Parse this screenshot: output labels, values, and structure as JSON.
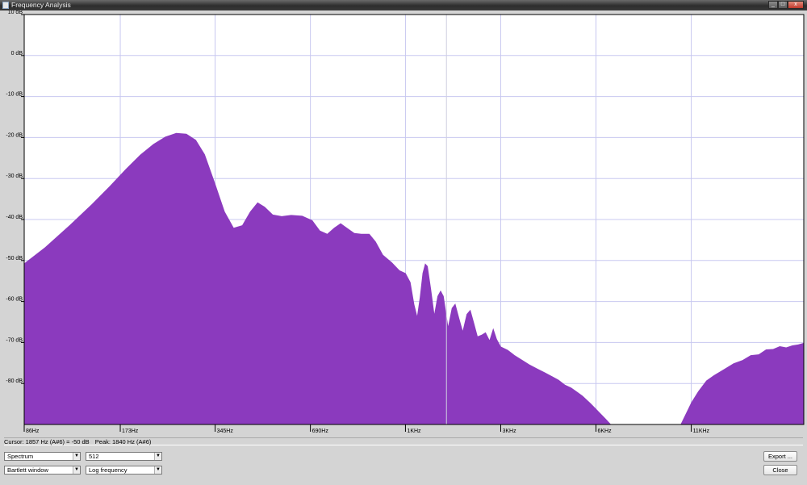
{
  "window": {
    "title": "Frequency Analysis",
    "min": "_",
    "max": "□",
    "close": "x"
  },
  "status": {
    "cursor": "Cursor: 1857 Hz (A#6) = -50 dB",
    "peak": "Peak: 1840 Hz (A#6)"
  },
  "controls": {
    "algorithm": "Spectrum",
    "size": "512",
    "window_function": "Bartlett window",
    "axis": "Log frequency",
    "export_label": "Export ...",
    "close_label": "Close"
  },
  "colors": {
    "fill": "#8b3abe",
    "grid": "#c8c8f0",
    "cursor_line": "#d0d0e0"
  },
  "chart_data": {
    "type": "area",
    "x_scale": "log",
    "xlim_hz": [
      86,
      25000
    ],
    "ylim_db": [
      -90,
      10
    ],
    "grid": true,
    "x_ticks": [
      {
        "hz": 86,
        "label": "86Hz"
      },
      {
        "hz": 173,
        "label": "173Hz"
      },
      {
        "hz": 345,
        "label": "345Hz"
      },
      {
        "hz": 690,
        "label": "690Hz"
      },
      {
        "hz": 1378,
        "label": "1KHz"
      },
      {
        "hz": 2756,
        "label": "3KHz"
      },
      {
        "hz": 5512,
        "label": "6KHz"
      },
      {
        "hz": 11025,
        "label": "11KHz"
      }
    ],
    "y_ticks": [
      {
        "db": 10,
        "label": "10 dB"
      },
      {
        "db": 0,
        "label": "0 dB"
      },
      {
        "db": -10,
        "label": "-10 dB"
      },
      {
        "db": -20,
        "label": "-20 dB"
      },
      {
        "db": -30,
        "label": "-30 dB"
      },
      {
        "db": -40,
        "label": "-40 dB"
      },
      {
        "db": -50,
        "label": "-50 dB"
      },
      {
        "db": -60,
        "label": "-60 dB"
      },
      {
        "db": -70,
        "label": "-70 dB"
      },
      {
        "db": -80,
        "label": "-80 dB"
      }
    ],
    "cursor_hz": 1857,
    "series": [
      {
        "points": [
          [
            86,
            -50.7
          ],
          [
            100,
            -46.8
          ],
          [
            120,
            -41.3
          ],
          [
            140,
            -36.4
          ],
          [
            160,
            -31.9
          ],
          [
            180,
            -27.7
          ],
          [
            200,
            -24.2
          ],
          [
            220,
            -21.6
          ],
          [
            240,
            -19.8
          ],
          [
            260,
            -18.9
          ],
          [
            280,
            -19.1
          ],
          [
            300,
            -20.6
          ],
          [
            320,
            -24.1
          ],
          [
            345,
            -31.2
          ],
          [
            370,
            -38.1
          ],
          [
            395,
            -42.0
          ],
          [
            420,
            -41.4
          ],
          [
            445,
            -38.1
          ],
          [
            470,
            -35.8
          ],
          [
            495,
            -36.9
          ],
          [
            525,
            -38.8
          ],
          [
            560,
            -39.2
          ],
          [
            600,
            -38.9
          ],
          [
            650,
            -39.1
          ],
          [
            700,
            -40.2
          ],
          [
            740,
            -42.7
          ],
          [
            780,
            -43.5
          ],
          [
            820,
            -42.0
          ],
          [
            860,
            -40.9
          ],
          [
            900,
            -42.0
          ],
          [
            950,
            -43.3
          ],
          [
            1000,
            -43.5
          ],
          [
            1060,
            -43.5
          ],
          [
            1110,
            -45.4
          ],
          [
            1170,
            -48.6
          ],
          [
            1250,
            -50.5
          ],
          [
            1320,
            -52.4
          ],
          [
            1380,
            -53.1
          ],
          [
            1430,
            -55.3
          ],
          [
            1470,
            -60.7
          ],
          [
            1500,
            -63.5
          ],
          [
            1530,
            -59.0
          ],
          [
            1560,
            -53.1
          ],
          [
            1590,
            -50.7
          ],
          [
            1620,
            -51.4
          ],
          [
            1660,
            -56.9
          ],
          [
            1700,
            -63.0
          ],
          [
            1740,
            -58.7
          ],
          [
            1780,
            -57.3
          ],
          [
            1820,
            -58.7
          ],
          [
            1880,
            -66.0
          ],
          [
            1930,
            -61.6
          ],
          [
            1980,
            -60.5
          ],
          [
            2040,
            -64.2
          ],
          [
            2090,
            -67.1
          ],
          [
            2150,
            -63.1
          ],
          [
            2210,
            -62.0
          ],
          [
            2270,
            -65.2
          ],
          [
            2330,
            -68.5
          ],
          [
            2400,
            -68.1
          ],
          [
            2470,
            -67.5
          ],
          [
            2540,
            -69.4
          ],
          [
            2610,
            -66.5
          ],
          [
            2680,
            -69.2
          ],
          [
            2760,
            -71.0
          ],
          [
            2900,
            -71.8
          ],
          [
            3050,
            -73.1
          ],
          [
            3200,
            -74.1
          ],
          [
            3400,
            -75.4
          ],
          [
            3600,
            -76.4
          ],
          [
            3800,
            -77.3
          ],
          [
            4000,
            -78.2
          ],
          [
            4200,
            -79.1
          ],
          [
            4400,
            -80.3
          ],
          [
            4600,
            -81.0
          ],
          [
            4800,
            -82.0
          ],
          [
            5000,
            -83.0
          ],
          [
            5300,
            -84.8
          ],
          [
            5600,
            -86.7
          ],
          [
            5900,
            -88.5
          ],
          [
            6150,
            -90.0
          ],
          [
            10200,
            -90.0
          ],
          [
            10500,
            -88.0
          ],
          [
            11025,
            -84.6
          ],
          [
            11600,
            -81.9
          ],
          [
            12300,
            -79.3
          ],
          [
            13000,
            -78.0
          ],
          [
            14000,
            -76.5
          ],
          [
            15000,
            -75.1
          ],
          [
            16000,
            -74.3
          ],
          [
            17000,
            -73.1
          ],
          [
            18000,
            -72.9
          ],
          [
            19000,
            -71.7
          ],
          [
            20000,
            -71.6
          ],
          [
            21000,
            -70.9
          ],
          [
            22000,
            -71.2
          ],
          [
            23000,
            -70.7
          ],
          [
            24000,
            -70.5
          ],
          [
            25000,
            -70.1
          ]
        ]
      }
    ]
  }
}
